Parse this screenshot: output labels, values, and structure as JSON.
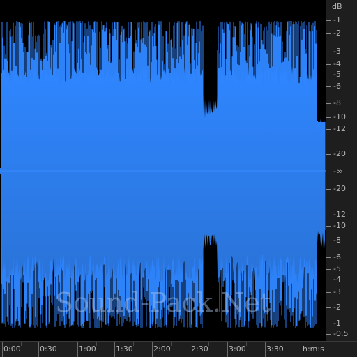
{
  "colors": {
    "background": "#000000",
    "waveform_top": "#2f86ff",
    "waveform_bottom": "#2a73d8",
    "ruler_bg": "#1e1e1e",
    "ruler_text": "#b5b5b5"
  },
  "db_ruler": {
    "unit": "dB",
    "labels": [
      "-1",
      "-2",
      "-3",
      "-4",
      "-5",
      "-6",
      "-8",
      "-10",
      "-12",
      "-20",
      "-∞",
      "-20",
      "-12",
      "-10",
      "-8",
      "-6",
      "-5",
      "-4",
      "-3",
      "-2",
      "-1",
      "-0,5"
    ]
  },
  "time_ruler": {
    "labels": [
      "0:00",
      "0:30",
      "1:00",
      "1:30",
      "2:00",
      "2:30",
      "3:00",
      "3:30"
    ],
    "unit": "h:m:s"
  },
  "watermark": "Sound-Pack.Net"
}
